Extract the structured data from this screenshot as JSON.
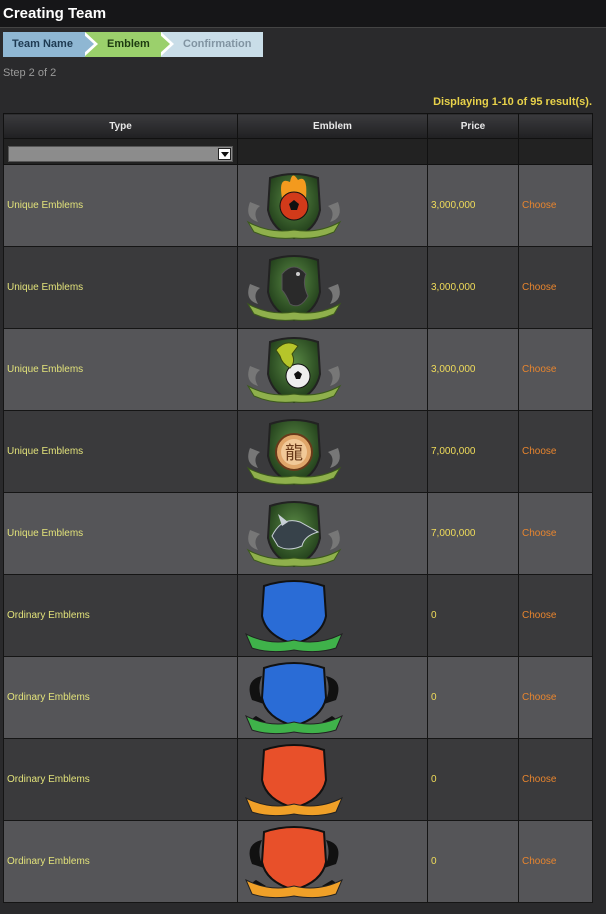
{
  "page": {
    "title": "Creating Team"
  },
  "steps": [
    {
      "label": "Team Name",
      "state": "done"
    },
    {
      "label": "Emblem",
      "state": "current"
    },
    {
      "label": "Confirmation",
      "state": "pending"
    }
  ],
  "step_indicator": "Step 2 of 2",
  "result_count": "Displaying 1-10 of 95 result(s).",
  "table": {
    "headers": {
      "type": "Type",
      "emblem": "Emblem",
      "price": "Price",
      "action": ""
    },
    "filter": {
      "selected": ""
    },
    "rows": [
      {
        "type": "Unique Emblems",
        "emblem": "flaming-soccer-ball-shield-icon",
        "price": "3,000,000",
        "action": "Choose"
      },
      {
        "type": "Unique Emblems",
        "emblem": "black-panther-shield-icon",
        "price": "3,000,000",
        "action": "Choose"
      },
      {
        "type": "Unique Emblems",
        "emblem": "dinosaur-soccer-ball-shield-icon",
        "price": "3,000,000",
        "action": "Choose"
      },
      {
        "type": "Unique Emblems",
        "emblem": "dragon-coin-shield-icon",
        "price": "7,000,000",
        "action": "Choose"
      },
      {
        "type": "Unique Emblems",
        "emblem": "wolf-head-shield-icon",
        "price": "7,000,000",
        "action": "Choose"
      },
      {
        "type": "Ordinary Emblems",
        "emblem": "blue-shield-green-ribbon-icon",
        "price": "0",
        "action": "Choose"
      },
      {
        "type": "Ordinary Emblems",
        "emblem": "blue-shield-black-wings-icon",
        "price": "0",
        "action": "Choose"
      },
      {
        "type": "Ordinary Emblems",
        "emblem": "red-shield-orange-ribbon-icon",
        "price": "0",
        "action": "Choose"
      },
      {
        "type": "Ordinary Emblems",
        "emblem": "red-shield-black-wings-icon",
        "price": "0",
        "action": "Choose"
      }
    ]
  },
  "colors": {
    "step_done": "#8fb7d3",
    "step_current": "#9bd06c",
    "step_pending": "#c9dde8",
    "type_text": "#e2e27a",
    "price_text": "#f0dc5a",
    "choose_text": "#e8852e"
  }
}
